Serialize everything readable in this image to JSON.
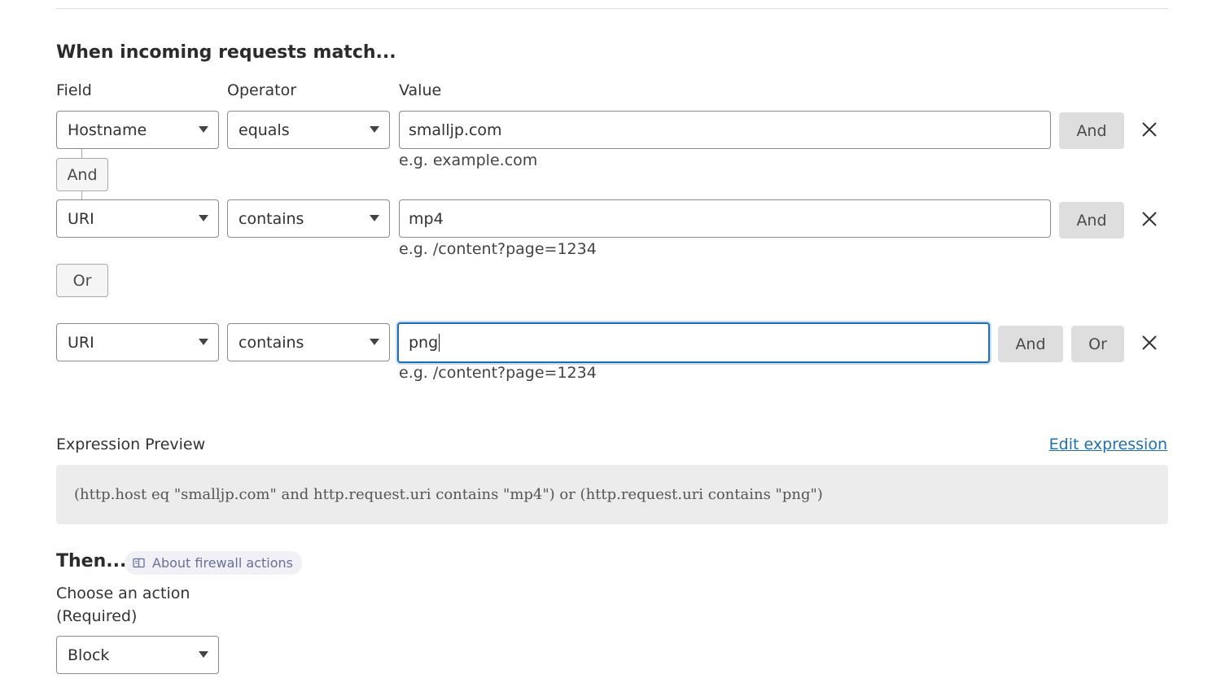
{
  "section_title": "When incoming requests match...",
  "columns": {
    "field": "Field",
    "operator": "Operator",
    "value": "Value"
  },
  "rows": [
    {
      "field": "Hostname",
      "operator": "equals",
      "value": "smalljp.com",
      "hint": "e.g. example.com",
      "and_label": "And"
    },
    {
      "field": "URI",
      "operator": "contains",
      "value": "mp4",
      "hint": "e.g. /content?page=1234",
      "and_label": "And"
    },
    {
      "field": "URI",
      "operator": "contains",
      "value": "png",
      "hint": "e.g. /content?page=1234",
      "and_label": "And",
      "or_label": "Or"
    }
  ],
  "connector_and_label": "And",
  "group_or_label": "Or",
  "expression_preview": {
    "label": "Expression Preview",
    "edit_link": "Edit expression",
    "text": "(http.host eq \"smalljp.com\" and http.request.uri contains \"mp4\") or (http.request.uri contains \"png\")"
  },
  "then": {
    "title": "Then...",
    "about_link": "About firewall actions",
    "choose_label": "Choose an action",
    "required_label": "(Required)",
    "action_value": "Block"
  },
  "colors": {
    "link": "#1f6fb0",
    "focus_border": "#1f6fb0",
    "button_bg": "#dedede",
    "preview_bg": "#ececec"
  },
  "icons": [
    "chevron-down-icon",
    "close-icon",
    "book-icon"
  ]
}
